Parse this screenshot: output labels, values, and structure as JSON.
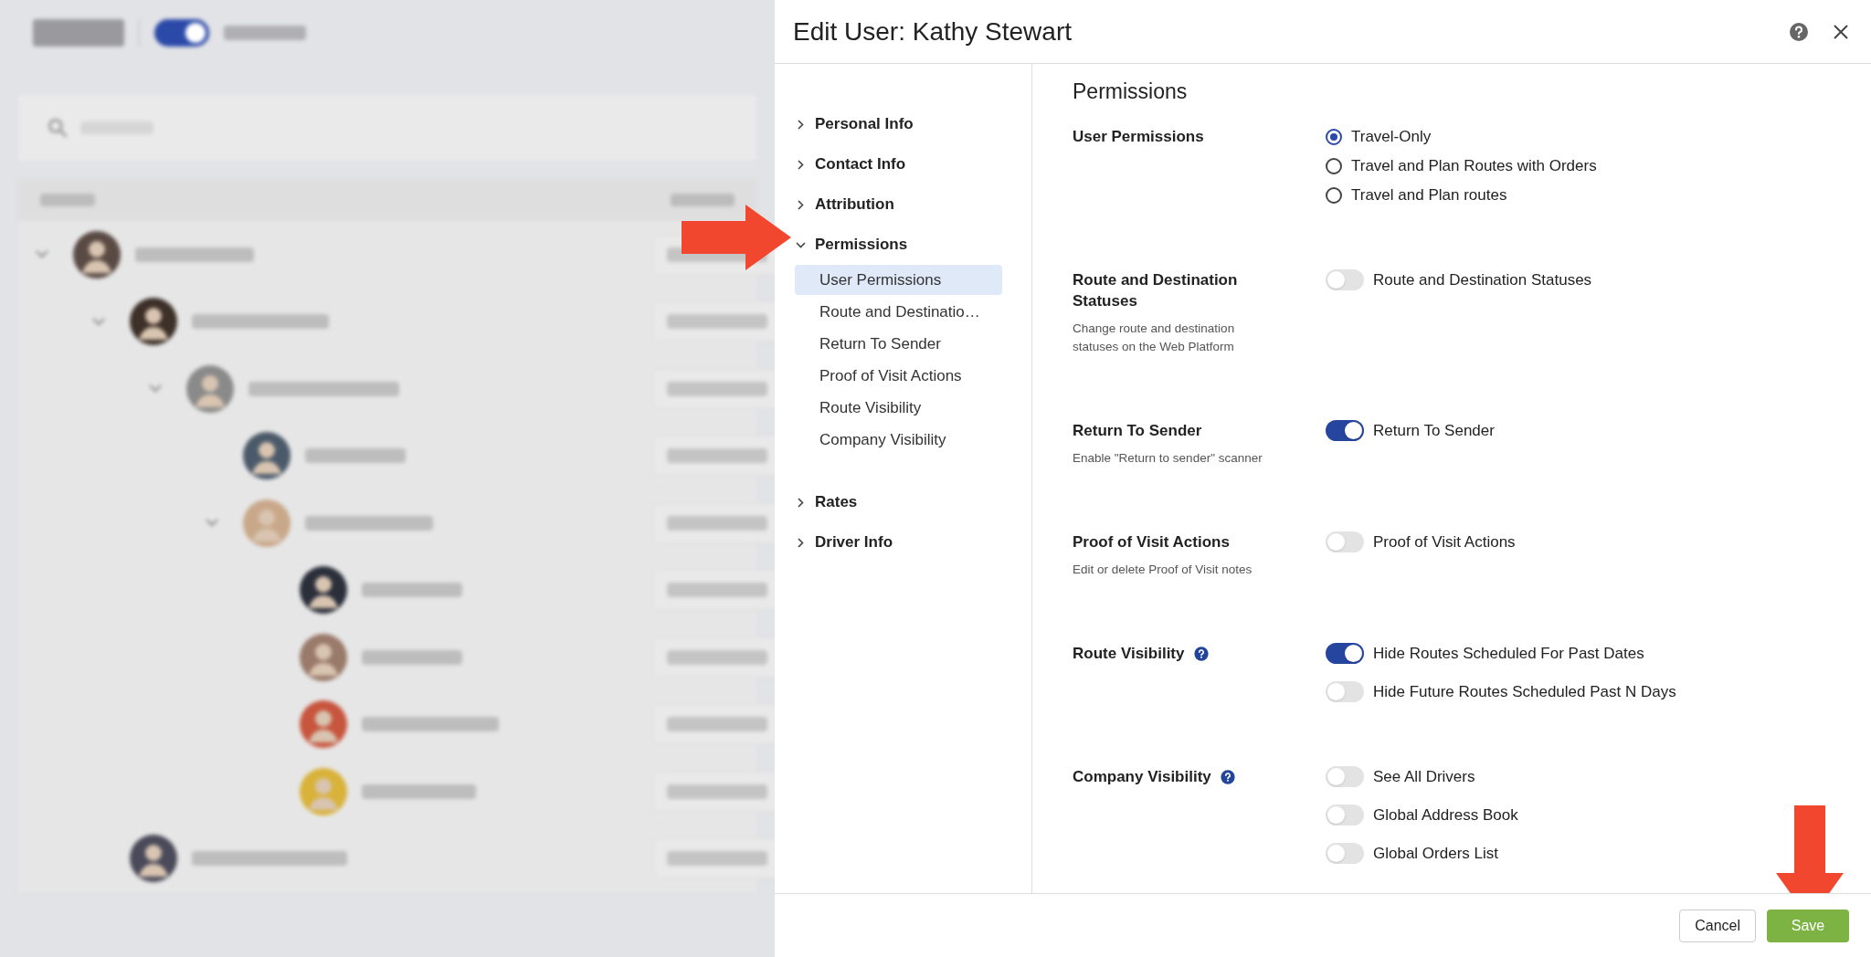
{
  "dialog": {
    "title": "Edit User: Kathy Stewart",
    "nav": [
      {
        "label": "Personal Info",
        "expanded": false
      },
      {
        "label": "Contact Info",
        "expanded": false
      },
      {
        "label": "Attribution",
        "expanded": false
      },
      {
        "label": "Permissions",
        "expanded": true,
        "children": [
          {
            "label": "User Permissions",
            "selected": true
          },
          {
            "label": "Route and Destinatio…",
            "selected": false
          },
          {
            "label": "Return To Sender",
            "selected": false
          },
          {
            "label": "Proof of Visit Actions",
            "selected": false
          },
          {
            "label": "Route Visibility",
            "selected": false
          },
          {
            "label": "Company Visibility",
            "selected": false
          }
        ]
      },
      {
        "label": "Rates",
        "expanded": false
      },
      {
        "label": "Driver Info",
        "expanded": false
      }
    ],
    "heading": "Permissions",
    "sections": [
      {
        "title": "User Permissions",
        "options": [
          {
            "kind": "radio",
            "label": "Travel-Only",
            "selected": true
          },
          {
            "kind": "radio",
            "label": "Travel and Plan Routes with Orders",
            "selected": false
          },
          {
            "kind": "radio",
            "label": "Travel and Plan routes",
            "selected": false
          }
        ]
      },
      {
        "title": "Route and Destination Statuses",
        "description": "Change route and destination statuses on the Web Platform",
        "options": [
          {
            "kind": "toggle",
            "label": "Route and Destination Statuses",
            "on": false
          }
        ]
      },
      {
        "title": "Return To Sender",
        "description": "Enable \"Return to sender\" scanner",
        "options": [
          {
            "kind": "toggle",
            "label": "Return To Sender",
            "on": true
          }
        ]
      },
      {
        "title": "Proof of Visit Actions",
        "description": "Edit or delete Proof of Visit notes",
        "options": [
          {
            "kind": "toggle",
            "label": "Proof of Visit Actions",
            "on": false
          }
        ]
      },
      {
        "title": "Route Visibility",
        "help": true,
        "options": [
          {
            "kind": "toggle",
            "label": "Hide Routes Scheduled For Past Dates",
            "on": true
          },
          {
            "kind": "toggle",
            "label": "Hide Future Routes Scheduled Past N Days",
            "on": false
          }
        ]
      },
      {
        "title": "Company Visibility",
        "help": true,
        "options": [
          {
            "kind": "toggle",
            "label": "See All Drivers",
            "on": false
          },
          {
            "kind": "toggle",
            "label": "Global Address Book",
            "on": false
          },
          {
            "kind": "toggle",
            "label": "Global Orders List",
            "on": false
          }
        ]
      }
    ],
    "buttons": [
      {
        "kind": "secondary",
        "label": "Cancel"
      },
      {
        "kind": "primary",
        "label": "Save"
      }
    ]
  }
}
